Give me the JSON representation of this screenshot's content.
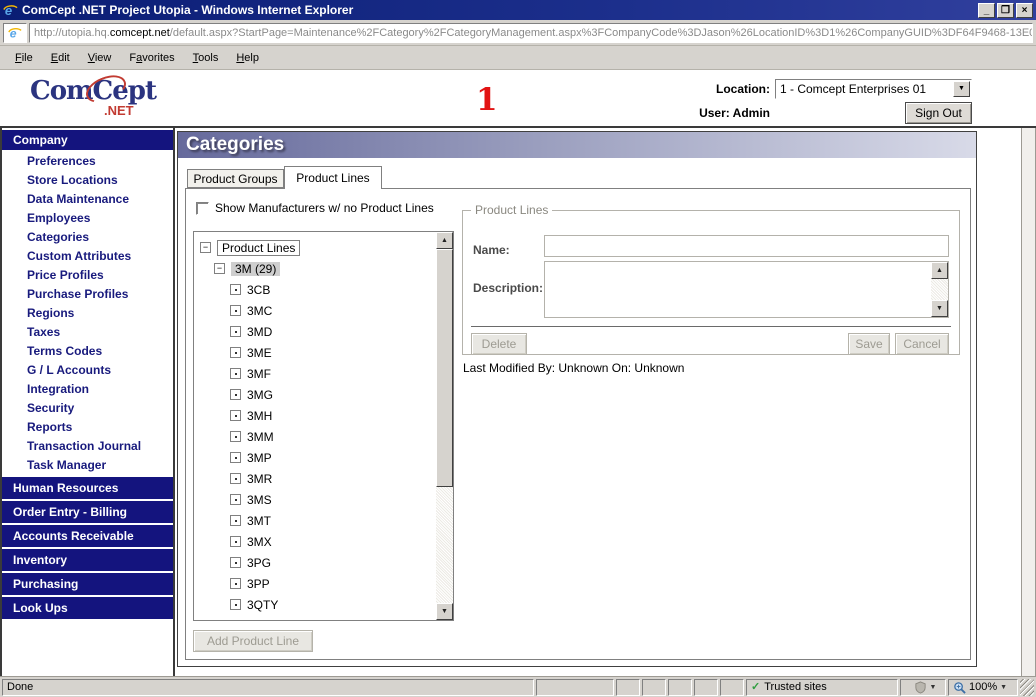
{
  "colors": {
    "titlebar_navy": "#0a1d74",
    "sidebar_navy": "#14147e",
    "banner_from": "#666a9c",
    "banner_to": "#d8dae8",
    "annotation_red": "#e21313",
    "chrome_gray": "#d6d3ce",
    "logo_navy": "#2b3480",
    "logo_red": "#c23b32",
    "trusted_green": "#2f9e3f"
  },
  "window": {
    "title": "ComCept .NET Project Utopia - Windows Internet Explorer",
    "controls": {
      "minimize": "_",
      "maximize": "❐",
      "close": "×"
    }
  },
  "address_bar": {
    "url_pre": "http://utopia.hq.",
    "url_domain": "comcept.net",
    "url_rest": "/default.aspx?StartPage=Maintenance%2FCategory%2FCategoryManagement.aspx%3FCompanyCode%3DJason%26LocationID%3D1%26CompanyGUID%3DF64F9468-13E0"
  },
  "menu": {
    "items": [
      {
        "pre": "",
        "key": "F",
        "post": "ile"
      },
      {
        "pre": "",
        "key": "E",
        "post": "dit"
      },
      {
        "pre": "",
        "key": "V",
        "post": "iew"
      },
      {
        "pre": "F",
        "key": "a",
        "post": "vorites"
      },
      {
        "pre": "",
        "key": "T",
        "post": "ools"
      },
      {
        "pre": "",
        "key": "H",
        "post": "elp"
      }
    ]
  },
  "header": {
    "logo_text": "ComCept",
    "logo_net": ".NET",
    "annotation": "1",
    "location_label": "Location:",
    "location_value": "1 - Comcept Enterprises 01",
    "user_label": "User: Admin",
    "sign_out_label": "Sign Out"
  },
  "sidebar": {
    "top_header": "Company",
    "company_items": [
      "Preferences",
      "Store Locations",
      "Data Maintenance",
      "Employees",
      "Categories",
      "Custom Attributes",
      "Price Profiles",
      "Purchase Profiles",
      "Regions",
      "Taxes",
      "Terms Codes",
      "G / L Accounts",
      "Integration",
      "Security",
      "Reports",
      "Transaction Journal",
      "Task Manager"
    ],
    "bottom_headers": [
      "Human Resources",
      "Order Entry - Billing",
      "Accounts Receivable",
      "Inventory",
      "Purchasing",
      "Look Ups"
    ]
  },
  "main": {
    "page_title": "Categories",
    "tabs": [
      {
        "label": "Product Groups"
      },
      {
        "label": "Product Lines"
      }
    ],
    "active_tab": "Product Lines",
    "show_checkbox_label": "Show Manufacturers w/ no Product Lines",
    "checkbox_checked": false,
    "tree": {
      "root": "Product Lines",
      "group": "3M (29)",
      "leaves": [
        "3CB",
        "3MC",
        "3MD",
        "3ME",
        "3MF",
        "3MG",
        "3MH",
        "3MM",
        "3MP",
        "3MR",
        "3MS",
        "3MT",
        "3MX",
        "3PG",
        "3PP",
        "3QTY"
      ]
    },
    "add_button_label": "Add Product Line",
    "form": {
      "legend": "Product Lines",
      "name_label": "Name:",
      "name_value": "",
      "description_label": "Description:",
      "description_value": "",
      "delete_label": "Delete",
      "save_label": "Save",
      "cancel_label": "Cancel"
    },
    "last_modified": "Last Modified By: Unknown On: Unknown"
  },
  "status_bar": {
    "status": "Done",
    "trusted_label": "Trusted sites",
    "zoom_level": "100%"
  },
  "icons": {
    "scroll_up": "▲",
    "scroll_down": "▼",
    "dropdown": "▼",
    "check": "✓",
    "minus": "−"
  }
}
